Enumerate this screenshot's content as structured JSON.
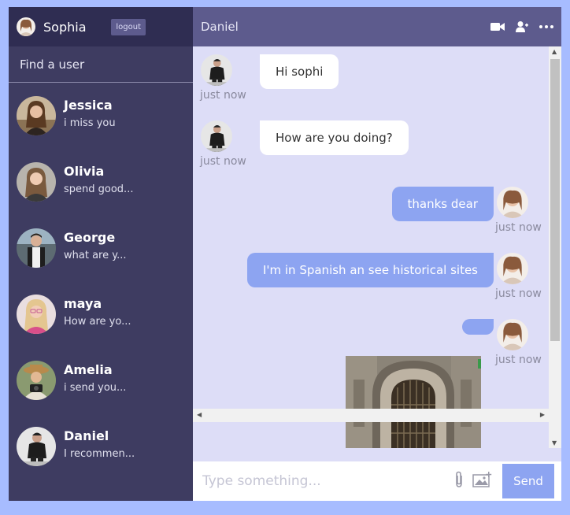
{
  "sidebar": {
    "user_name": "Sophia",
    "logout_label": "logout",
    "search_placeholder": "Find a user",
    "chats": [
      {
        "name": "Jessica",
        "last": "i miss you"
      },
      {
        "name": "Olivia",
        "last": "spend good..."
      },
      {
        "name": "George",
        "last": "what are y..."
      },
      {
        "name": "maya",
        "last": "How are yo..."
      },
      {
        "name": "Amelia",
        "last": "i send you..."
      },
      {
        "name": "Daniel",
        "last": "I recommen..."
      }
    ]
  },
  "chat": {
    "title": "Daniel",
    "icons": [
      "video-camera-icon",
      "add-user-icon",
      "more-options-icon"
    ],
    "messages": [
      {
        "owner": "other",
        "text": "Hi sophi",
        "time": "just now"
      },
      {
        "owner": "other",
        "text": "How are you doing?",
        "time": "just now"
      },
      {
        "owner": "me",
        "text": "thanks dear",
        "time": "just now"
      },
      {
        "owner": "me",
        "text": "I'm in Spanish an see historical sites",
        "time": "just now"
      },
      {
        "owner": "me",
        "text": "",
        "time": "just now",
        "has_image": true
      }
    ],
    "input_placeholder": "Type something...",
    "send_label": "Send"
  },
  "colors": {
    "page_bg": "#a7bcff",
    "sidebar_bg": "#3e3c61",
    "sidebar_header_bg": "#2f2d52",
    "chat_header_bg": "#5d5b8d",
    "messages_bg": "#ddddf7",
    "own_bubble": "#8da4f1"
  }
}
